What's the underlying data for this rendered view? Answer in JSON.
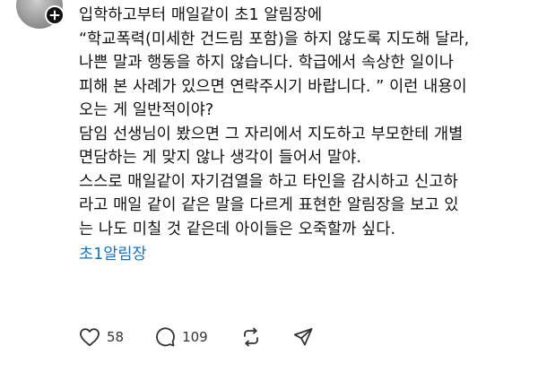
{
  "post": {
    "lines": [
      "입학하고부터 매일같이 초1 알림장에",
      "“학교폭력(미세한 건드림 포함)을 하지 않도록 지도해 달라,",
      "나쁜 말과 행동을 하지 않습니다. 학급에서 속상한 일이나",
      "피해 본 사례가 있으면 연락주시기 바랍니다. ” 이런 내용이",
      "오는 게 일반적이야?",
      "담임 선생님이 봤으면 그 자리에서 지도하고 부모한테 개별",
      "면담하는 게 맞지 않나 생각이 들어서 말야.",
      "스스로 매일같이 자기검열을 하고 타인을 감시하고 신고하",
      "라고 매일 같이 같은 말을 다르게 표현한 알림장을 보고 있",
      "는 나도 미칠 것 같은데 아이들은 오죽할까 싶다."
    ],
    "tag": "초1알림장"
  },
  "actions": {
    "like_count": "58",
    "reply_count": "109"
  },
  "icons": {
    "follow": "plus-icon",
    "like": "heart-icon",
    "reply": "comment-icon",
    "repost": "repost-icon",
    "share": "send-icon"
  },
  "colors": {
    "tag": "#1a73b8",
    "text": "#111111",
    "badge": "#111111"
  }
}
